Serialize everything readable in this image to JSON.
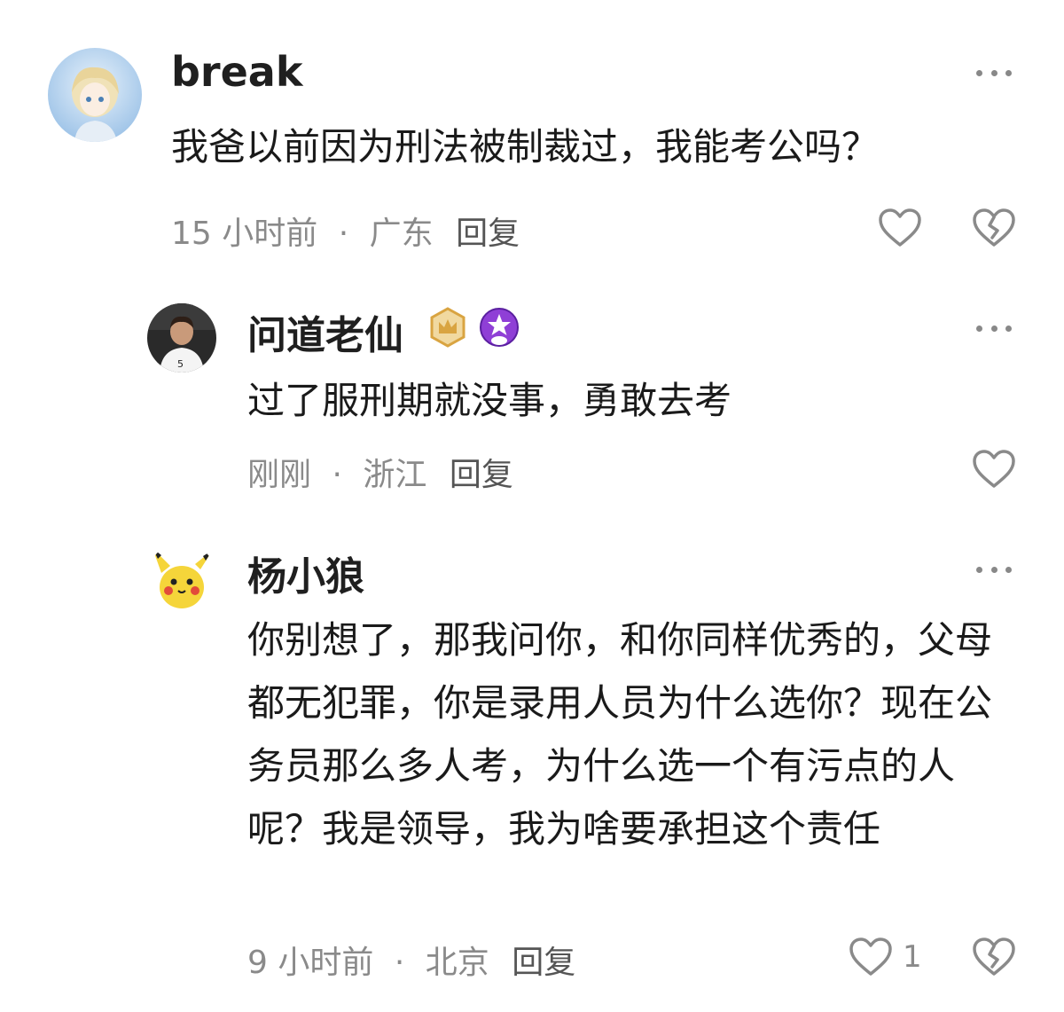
{
  "comments": [
    {
      "username": "break",
      "content": "我爸以前因为刑法被制裁过，我能考公吗？",
      "time": "15 小时前",
      "separator": "·",
      "location": "广东",
      "reply_label": "回复",
      "avatar_icon": "anime-girl-avatar"
    },
    {
      "username": "问道老仙",
      "content": "过了服刑期就没事，勇敢去考",
      "time": "刚刚",
      "separator": "·",
      "location": "浙江",
      "reply_label": "回复",
      "avatar_icon": "football-player-avatar",
      "badges": [
        "gold-crown-badge",
        "purple-star-badge"
      ]
    },
    {
      "username": "杨小狼",
      "content": "你别想了，那我问你，和你同样优秀的，父母都无犯罪，你是录用人员为什么选你？现在公务员那么多人考，为什么选一个有污点的人呢？我是领导，我为啥要承担这个责任",
      "time": "9 小时前",
      "separator": "·",
      "location": "北京",
      "reply_label": "回复",
      "like_count": "1",
      "avatar_icon": "pikachu-avatar"
    }
  ],
  "colors": {
    "text": "#1a1a1a",
    "meta": "#8a8a8a",
    "icon": "#8a8a8a",
    "crown_badge": "#d9a441",
    "star_badge": "#8f3fd6"
  }
}
